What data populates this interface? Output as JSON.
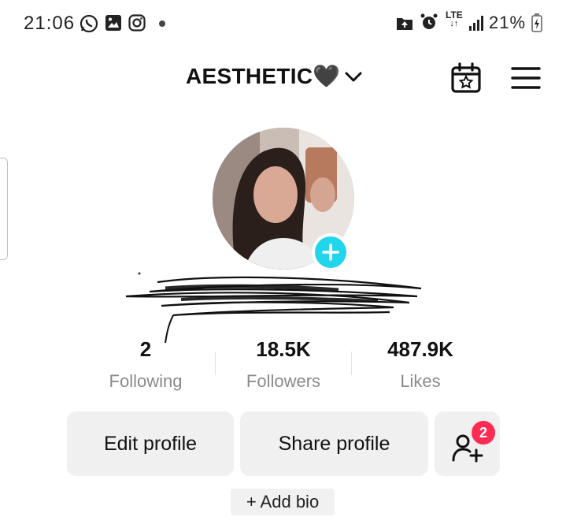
{
  "status_bar": {
    "time": "21:06",
    "network": "LTE",
    "battery": "21%",
    "icons": [
      "whatsapp-icon",
      "gallery-icon",
      "instagram-icon",
      "dot-icon",
      "upload-icon",
      "alarm-icon",
      "signal-icon",
      "battery-icon"
    ]
  },
  "header": {
    "username": "AESTHETIC🖤",
    "icons": [
      "chevron-down-icon",
      "calendar-star-icon",
      "menu-icon"
    ]
  },
  "profile": {
    "avatar": "avatar",
    "handle_redacted": true
  },
  "stats": [
    {
      "value": "2",
      "label": "Following"
    },
    {
      "value": "18.5K",
      "label": "Followers"
    },
    {
      "value": "487.9K",
      "label": "Likes"
    }
  ],
  "actions": {
    "edit_profile": "Edit profile",
    "share_profile": "Share profile",
    "friend_requests_badge": "2",
    "add_bio": "+ Add bio"
  },
  "colors": {
    "accent_cyan": "#20d5ec",
    "badge_red": "#fe2c55",
    "button_bg": "#f0f0f0"
  }
}
